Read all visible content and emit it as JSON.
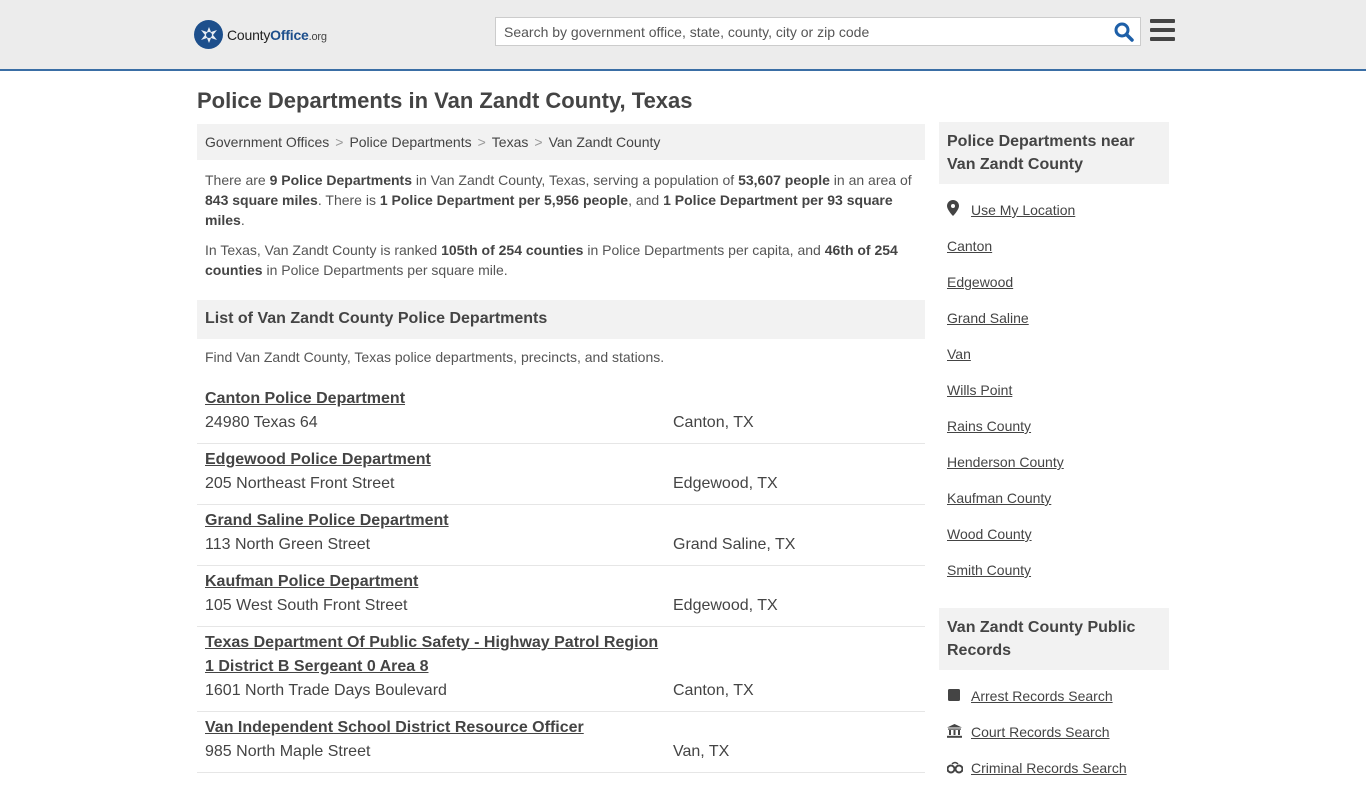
{
  "header": {
    "logo_county": "County",
    "logo_office": "Office",
    "logo_suffix": ".org",
    "search_placeholder": "Search by government office, state, county, city or zip code"
  },
  "page_title": "Police Departments in Van Zandt County, Texas",
  "breadcrumb": [
    "Government Offices",
    "Police Departments",
    "Texas",
    "Van Zandt County"
  ],
  "summary": {
    "p1_a": "There are ",
    "p1_b": "9 Police Departments",
    "p1_c": " in Van Zandt County, Texas, serving a population of ",
    "p1_d": "53,607 people",
    "p1_e": " in an area of ",
    "p1_f": "843 square miles",
    "p1_g": ". There is ",
    "p1_h": "1 Police Department per 5,956 people",
    "p1_i": ", and ",
    "p1_j": "1 Police Department per 93 square miles",
    "p1_k": ".",
    "p2_a": "In Texas, Van Zandt County is ranked ",
    "p2_b": "105th of 254 counties",
    "p2_c": " in Police Departments per capita, and ",
    "p2_d": "46th of 254 counties",
    "p2_e": " in Police Departments per square mile."
  },
  "list": {
    "heading": "List of Van Zandt County Police Departments",
    "intro": "Find Van Zandt County, Texas police departments, precincts, and stations.",
    "items": [
      {
        "name": "Canton Police Department",
        "address": "24980 Texas 64",
        "city": "Canton, TX"
      },
      {
        "name": "Edgewood Police Department",
        "address": "205 Northeast Front Street",
        "city": "Edgewood, TX"
      },
      {
        "name": "Grand Saline Police Department",
        "address": "113 North Green Street",
        "city": "Grand Saline, TX"
      },
      {
        "name": "Kaufman Police Department",
        "address": "105 West South Front Street",
        "city": "Edgewood, TX"
      },
      {
        "name": "Texas Department Of Public Safety - Highway Patrol Region 1 District B Sergeant 0 Area 8",
        "address": "1601 North Trade Days Boulevard",
        "city": "Canton, TX"
      },
      {
        "name": "Van Independent School District Resource Officer",
        "address": "985 North Maple Street",
        "city": "Van, TX"
      }
    ]
  },
  "sidebar": {
    "nearby_heading": "Police Departments near Van Zandt County",
    "use_location": "Use My Location",
    "nearby": [
      "Canton",
      "Edgewood",
      "Grand Saline",
      "Van",
      "Wills Point",
      "Rains County",
      "Henderson County",
      "Kaufman County",
      "Wood County",
      "Smith County"
    ],
    "records_heading": "Van Zandt County Public Records",
    "records": [
      {
        "label": "Arrest Records Search",
        "icon": "square-icon"
      },
      {
        "label": "Court Records Search",
        "icon": "courthouse-icon"
      },
      {
        "label": "Criminal Records Search",
        "icon": "handcuffs-icon"
      }
    ]
  },
  "colors": {
    "accent": "#3a6ea5",
    "brand": "#1d4f8c",
    "search_icon": "#1d5fa8"
  }
}
